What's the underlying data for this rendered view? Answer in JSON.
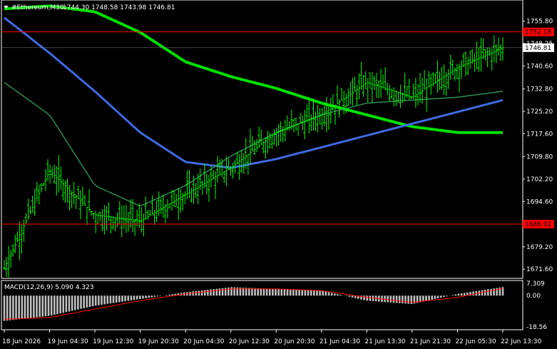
{
  "header": {
    "symbol_text": "#Ethereum,M30",
    "ohlc_text": "1744.30 1748.58 1743.98 1746.81"
  },
  "price_axis": {
    "ticks": [
      "1755.80",
      "1748.25",
      "1740.60",
      "1732.80",
      "1725.20",
      "1717.60",
      "1709.80",
      "1702.20",
      "1694.60",
      "1687.00",
      "1679.20",
      "1671.60"
    ],
    "current_price": "1746.81",
    "level_high": "1752.18",
    "level_low": "1686.92"
  },
  "macd": {
    "label": "MACD(12,26,9) 5.090 4.323",
    "ticks": [
      "7.309",
      "0.00",
      "-18.56"
    ]
  },
  "time_axis": {
    "ticks": [
      "18 Jun 2026",
      "19 Jun 04:30",
      "19 Jun 12:30",
      "19 Jun 20:30",
      "20 Jun 04:30",
      "20 Jun 12:30",
      "20 Jun 20:30",
      "21 Jun 04:30",
      "21 Jun 13:30",
      "21 Jun 21:30",
      "22 Jun 05:30",
      "22 Jun 13:30"
    ]
  },
  "colors": {
    "background": "#000000",
    "bar": "#00ff00",
    "level_line": "#ff0000",
    "ma_fast": "#00e000",
    "ma_mid": "#4169e1",
    "ma_slow": "#2e8b57",
    "macd_hist": "#c0c0c0",
    "macd_signal": "#ff0000"
  },
  "chart_data": {
    "type": "line",
    "title": "#Ethereum,M30",
    "ylim": [
      1668.5,
      1763.0
    ],
    "x": [
      "18 Jun 2026",
      "19 Jun 04:30",
      "19 Jun 12:30",
      "19 Jun 20:30",
      "20 Jun 04:30",
      "20 Jun 12:30",
      "20 Jun 20:30",
      "21 Jun 04:30",
      "21 Jun 13:30",
      "21 Jun 21:30",
      "22 Jun 05:30",
      "22 Jun 13:30"
    ],
    "series": [
      {
        "values": [
          1672,
          1705,
          1690,
          1688,
          1697,
          1706,
          1718,
          1724,
          1735,
          1730,
          1740,
          1746.81
        ]
      },
      {
        "values": [
          1760,
          1761,
          1759,
          1752,
          1742,
          1737,
          1733,
          1728,
          1724,
          1720,
          1718,
          1718
        ]
      },
      {
        "values": [
          1757,
          1745,
          1732,
          1718,
          1708,
          1706,
          1709,
          1713,
          1717,
          1721,
          1725,
          1729
        ]
      },
      {
        "values": [
          1735,
          1724,
          1700,
          1693,
          1700,
          1710,
          1718,
          1724,
          1728,
          1729,
          1730,
          1732
        ]
      }
    ],
    "hlines": [
      1752.18,
      1686.92
    ],
    "macd": {
      "ylim": [
        -18.56,
        7.309
      ],
      "histogram": [
        -15,
        -12,
        -6,
        -2,
        2,
        5,
        4,
        3,
        -3,
        -5,
        1,
        5.09
      ],
      "signal": [
        -14,
        -13,
        -8,
        -3,
        1,
        4,
        4,
        3,
        -1,
        -4,
        -1,
        4.323
      ]
    }
  }
}
